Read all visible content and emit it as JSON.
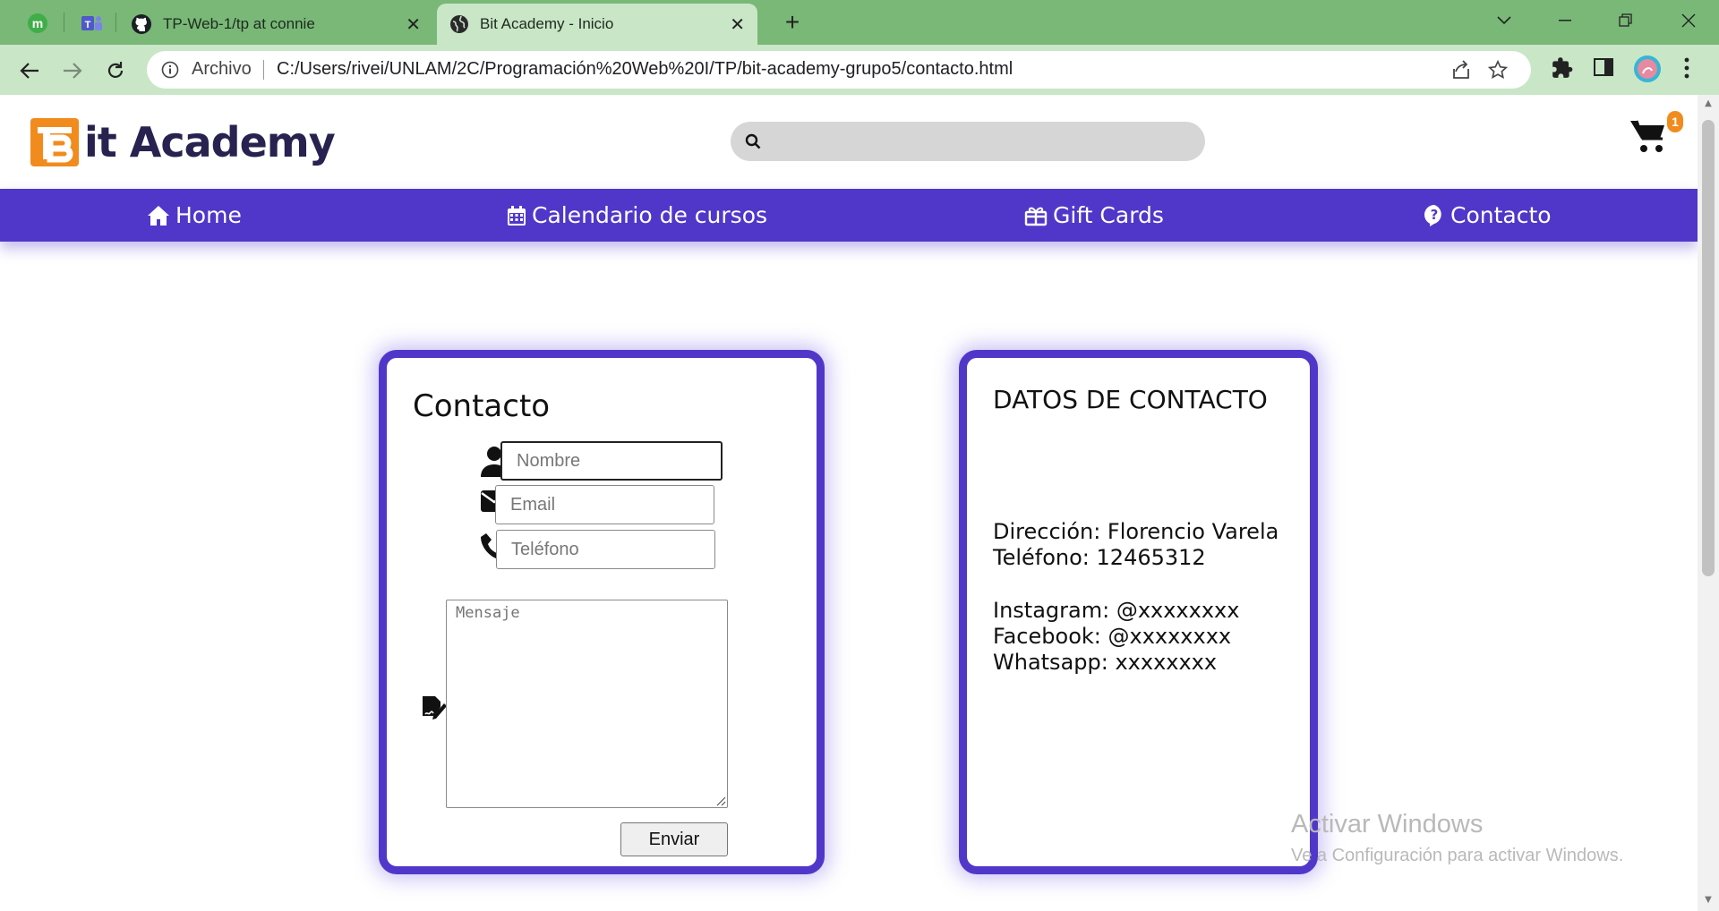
{
  "browser": {
    "tabs": [
      {
        "title": "TP-Web-1/tp at connie",
        "icon": "github-icon"
      },
      {
        "title": "Bit Academy - Inicio",
        "icon": "globe-icon",
        "active": true
      }
    ],
    "pinned": [
      "meet-icon",
      "teams-icon"
    ],
    "new_tab_label": "+",
    "omnibox": {
      "scheme_label": "Archivo",
      "url": "C:/Users/rivei/UNLAM/2C/Programación%20Web%20I/TP/bit-academy-grupo5/contacto.html"
    }
  },
  "site": {
    "logo_letter": "B",
    "logo_text": "it Academy",
    "search_placeholder": "",
    "cart_count": "1",
    "colors": {
      "brand": "#5137c9",
      "accent": "#f28b1d",
      "logo_text": "#27224f"
    }
  },
  "nav": {
    "items": [
      {
        "label": "Home",
        "icon": "home-icon"
      },
      {
        "label": "Calendario de cursos",
        "icon": "calendar-icon"
      },
      {
        "label": "Gift Cards",
        "icon": "gift-icon"
      },
      {
        "label": "Contacto",
        "icon": "question-circle-icon"
      }
    ]
  },
  "form": {
    "title": "Contacto",
    "name_placeholder": "Nombre",
    "email_placeholder": "Email",
    "phone_placeholder": "Teléfono",
    "message_placeholder": "Mensaje",
    "submit_label": "Enviar"
  },
  "info": {
    "title": "DATOS DE CONTACTO",
    "address": "Dirección: Florencio Varela",
    "phone": "Teléfono: 12465312",
    "instagram": "Instagram: @xxxxxxxx",
    "facebook": "Facebook: @xxxxxxxx",
    "whatsapp": "Whatsapp: xxxxxxxx"
  },
  "watermark": {
    "title": "Activar Windows",
    "subtitle": "Ve a Configuración para activar Windows."
  }
}
